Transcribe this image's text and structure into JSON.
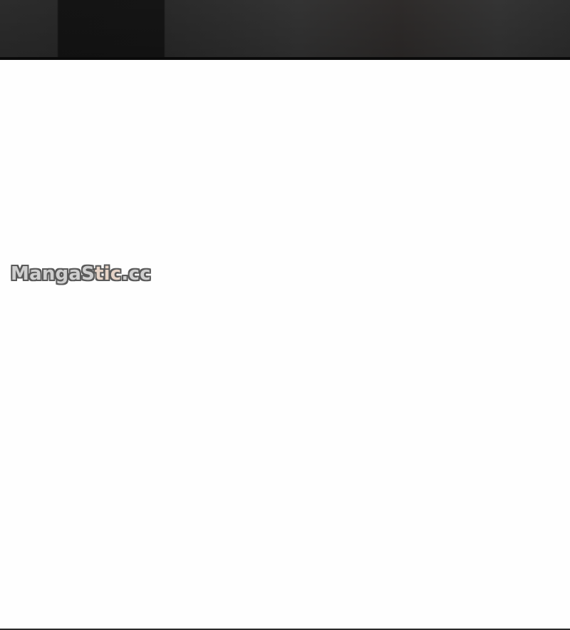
{
  "watermark": {
    "text_part1": "MangaS",
    "text_part2": "tic",
    "text_part3": ".cc"
  },
  "colors": {
    "top_panel": "#2c2c2c",
    "panel_border": "#0a0a0a",
    "background": "#fefefe",
    "watermark_fill": "#cfcfcf",
    "watermark_outline": "#5a5a5a"
  }
}
